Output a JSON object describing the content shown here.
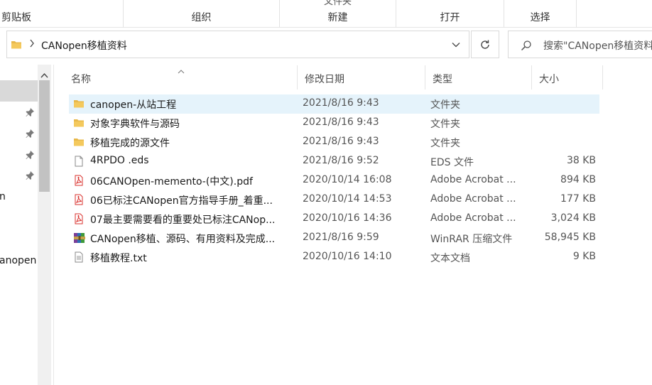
{
  "ribbon": {
    "groups": [
      {
        "label": "剪贴板",
        "peek": ""
      },
      {
        "label": "组织",
        "peek": ""
      },
      {
        "label": "新建",
        "peek": "文件夹"
      },
      {
        "label": "打开",
        "peek": ""
      },
      {
        "label": "选择",
        "peek": ""
      }
    ]
  },
  "address": {
    "path": "CANopen移植资料"
  },
  "search": {
    "placeholder": "搜索\"CANopen移植资料\""
  },
  "nav": {
    "items": [
      {
        "label": "n"
      },
      {
        "label": "anopen"
      }
    ]
  },
  "columns": {
    "name": "名称",
    "date": "修改日期",
    "type": "类型",
    "size": "大小"
  },
  "files": [
    {
      "name": "canopen-从站工程",
      "date": "2021/8/16 9:43",
      "type": "文件夹",
      "size": "",
      "icon": "folder-icon"
    },
    {
      "name": "对象字典软件与源码",
      "date": "2021/8/16 9:43",
      "type": "文件夹",
      "size": "",
      "icon": "folder-icon"
    },
    {
      "name": "移植完成的源文件",
      "date": "2021/8/16 9:43",
      "type": "文件夹",
      "size": "",
      "icon": "folder-icon"
    },
    {
      "name": "4RPDO .eds",
      "date": "2021/8/16 9:52",
      "type": "EDS 文件",
      "size": "38 KB",
      "icon": "file-icon"
    },
    {
      "name": "06CANOpen-memento-(中文).pdf",
      "date": "2020/10/14 16:08",
      "type": "Adobe Acrobat ...",
      "size": "894 KB",
      "icon": "pdf-icon"
    },
    {
      "name": "06已标注CANopen官方指导手册_着重...",
      "date": "2020/10/14 14:53",
      "type": "Adobe Acrobat ...",
      "size": "177 KB",
      "icon": "pdf-icon"
    },
    {
      "name": "07最主要需要看的重要处已标注CANop...",
      "date": "2020/10/16 14:36",
      "type": "Adobe Acrobat ...",
      "size": "3,024 KB",
      "icon": "pdf-icon"
    },
    {
      "name": "CANopen移植、源码、有用资料及完成...",
      "date": "2021/8/16 9:59",
      "type": "WinRAR 压缩文件",
      "size": "58,945 KB",
      "icon": "archive-icon"
    },
    {
      "name": "移植教程.txt",
      "date": "2020/10/16 14:10",
      "type": "文本文档",
      "size": "9 KB",
      "icon": "text-file-icon"
    }
  ],
  "colors": {
    "folder": "#E8B84A",
    "pdf": "#D9302C",
    "selection": "#E5F3FB",
    "nav_selected": "#D9D9D9"
  }
}
